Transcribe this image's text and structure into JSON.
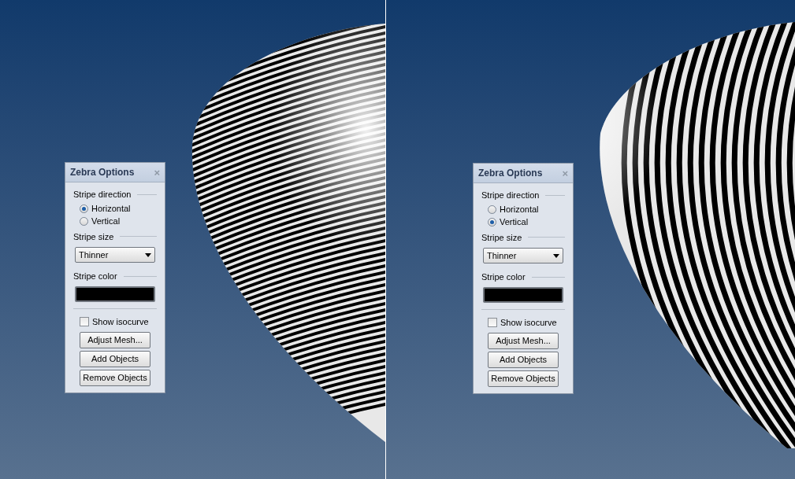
{
  "viewports": [
    {
      "panel": {
        "title": "Zebra Options",
        "close": "×",
        "direction_label": "Stripe direction",
        "directions": [
          {
            "label": "Horizontal",
            "selected": true
          },
          {
            "label": "Vertical",
            "selected": false
          }
        ],
        "size_label": "Stripe size",
        "size_value": "Thinner",
        "color_label": "Stripe color",
        "swatch": {
          "color": "#000000"
        },
        "isocurve": {
          "label": "Show isocurve",
          "checked": false
        },
        "buttons": [
          "Adjust Mesh...",
          "Add Objects",
          "Remove Objects"
        ]
      }
    },
    {
      "panel": {
        "title": "Zebra Options",
        "close": "×",
        "direction_label": "Stripe direction",
        "directions": [
          {
            "label": "Horizontal",
            "selected": false
          },
          {
            "label": "Vertical",
            "selected": true
          }
        ],
        "size_label": "Stripe size",
        "size_value": "Thinner",
        "color_label": "Stripe color",
        "swatch": {
          "color": "#000000"
        },
        "isocurve": {
          "label": "Show isocurve",
          "checked": false
        },
        "buttons": [
          "Adjust Mesh...",
          "Add Objects",
          "Remove Objects"
        ]
      }
    }
  ]
}
